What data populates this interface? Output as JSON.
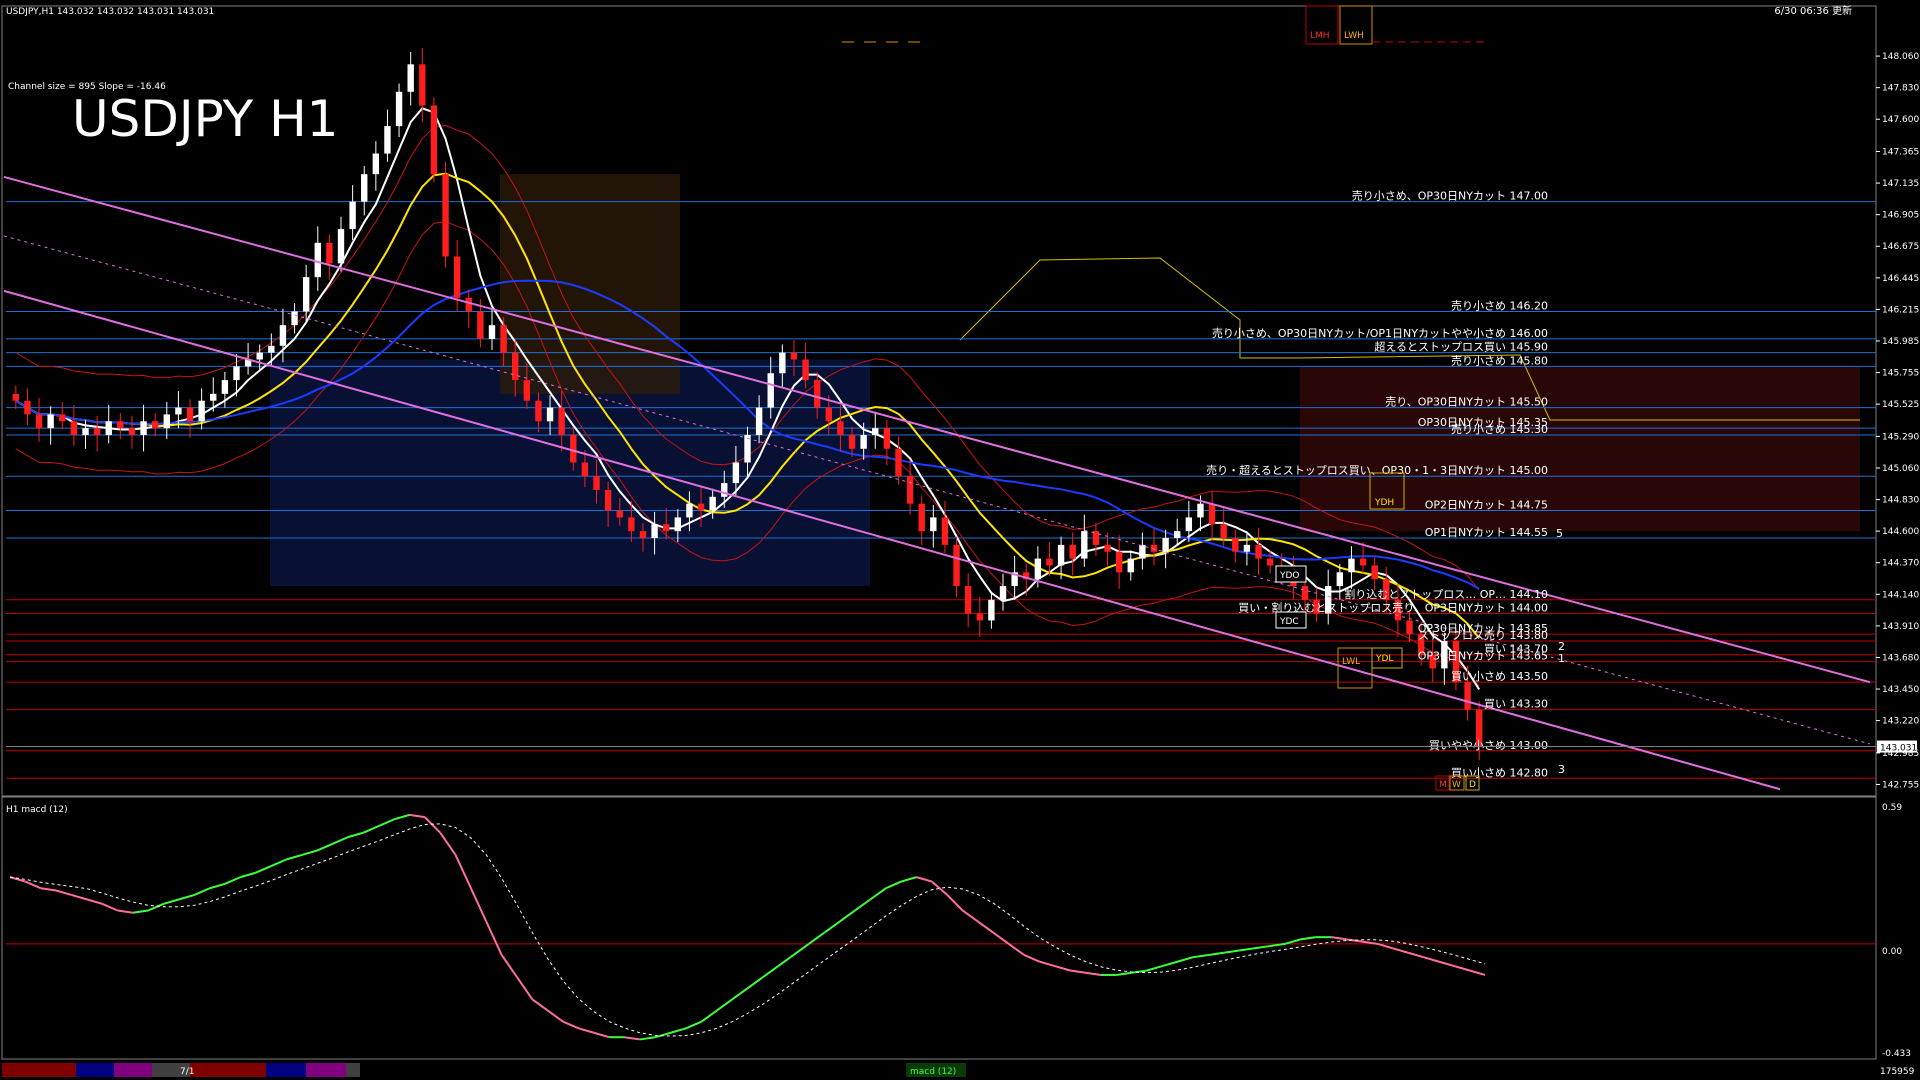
{
  "header": {
    "symbol_line": "USDJPY,H1  143.032 143.032 143.031 143.031",
    "datetime": "6/30 06:36 更新",
    "channel_info": "Channel size = 895 Slope = -16.46",
    "big_title": "USDJPY H1"
  },
  "markers_top": {
    "lmh": "LMH",
    "lwh": "LWH"
  },
  "boxes": {
    "ydh": "YDH",
    "ydo": "YDO",
    "ydc": "YDC",
    "ydl": "YDL",
    "lwl": "LWL",
    "m": "M",
    "w": "W",
    "d": "D"
  },
  "price_axis": {
    "ticks": [
      "148.060",
      "147.830",
      "147.600",
      "147.365",
      "147.135",
      "146.905",
      "146.675",
      "146.445",
      "146.215",
      "145.985",
      "145.755",
      "145.525",
      "145.290",
      "145.060",
      "144.830",
      "144.600",
      "144.370",
      "144.140",
      "143.910",
      "143.680",
      "143.450",
      "143.220",
      "142.985",
      "142.755"
    ],
    "current_price": "143.031"
  },
  "macd_axis": {
    "ticks": [
      "0.59",
      "0.00",
      "-0.433"
    ],
    "label": "H1  macd (12)"
  },
  "levels": [
    {
      "price": 147.0,
      "text": "売り小さめ、OP30日NYカット 147.00",
      "color": "#1e6fd9"
    },
    {
      "price": 146.2,
      "text": "売り小さめ 146.20",
      "color": "#1e6fd9"
    },
    {
      "price": 146.0,
      "text": "売り小さめ、OP30日NYカット/OP1日NYカットやや小さめ 146.00",
      "color": "#1e6fd9"
    },
    {
      "price": 145.9,
      "text": "超えるとストップロス買い 145.90",
      "color": "#1e6fd9"
    },
    {
      "price": 145.8,
      "text": "売り小さめ 145.80",
      "color": "#1e6fd9"
    },
    {
      "price": 145.5,
      "text": "売り、OP30日NYカット 145.50",
      "color": "#1e6fd9"
    },
    {
      "price": 145.35,
      "text": "OP30日NYカット 145.35",
      "color": "#1e6fd9"
    },
    {
      "price": 145.3,
      "text": "売り小さめ 145.30",
      "color": "#1e6fd9"
    },
    {
      "price": 145.0,
      "text": "売り・超えるとストップロス買い、OP30・1・3日NYカット 145.00",
      "color": "#1e6fd9"
    },
    {
      "price": 144.75,
      "text": "OP2日NYカット 144.75",
      "color": "#1e6fd9"
    },
    {
      "price": 144.55,
      "text": "OP1日NYカット 144.55",
      "color": "#1e6fd9"
    },
    {
      "price": 144.1,
      "text": "割り込むとストップロス… OP… 144.10",
      "color": "#c00000"
    },
    {
      "price": 144.0,
      "text": "買い・割り込むとストップロス売り、OP3日NYカット 144.00",
      "color": "#c00000"
    },
    {
      "price": 143.85,
      "text": "OP30日NYカット 143.85",
      "color": "#c00000"
    },
    {
      "price": 143.8,
      "text": "ストップロス売り 143.80",
      "color": "#c00000"
    },
    {
      "price": 143.7,
      "text": "買い 143.70",
      "color": "#c00000"
    },
    {
      "price": 143.65,
      "text": "OP30日NYカット 143.65",
      "color": "#c00000"
    },
    {
      "price": 143.5,
      "text": "買い小さめ 143.50",
      "color": "#c00000"
    },
    {
      "price": 143.3,
      "text": "買い 143.30",
      "color": "#c00000"
    },
    {
      "price": 143.0,
      "text": "買いやや小さめ 143.00",
      "color": "#c00000"
    },
    {
      "price": 142.8,
      "text": "買い小さめ 142.80",
      "color": "#c00000"
    }
  ],
  "channel_numbers": [
    "5",
    "2",
    "1",
    "3"
  ],
  "bottom_bar": {
    "tab_label": "7/1",
    "indicator": "macd (12)",
    "counter": "175959"
  },
  "chart_data": {
    "type": "candlestick",
    "title": "USDJPY H1",
    "ylim": [
      142.7,
      148.25
    ],
    "macd_ylim": [
      -0.5,
      0.62
    ],
    "closes": [
      145.55,
      145.45,
      145.35,
      145.45,
      145.4,
      145.3,
      145.35,
      145.3,
      145.4,
      145.35,
      145.3,
      145.4,
      145.35,
      145.45,
      145.5,
      145.4,
      145.55,
      145.6,
      145.7,
      145.8,
      145.85,
      145.9,
      145.95,
      146.1,
      146.2,
      146.45,
      146.7,
      146.55,
      146.8,
      147.0,
      147.2,
      147.35,
      147.55,
      147.8,
      148.0,
      147.7,
      147.2,
      146.6,
      146.3,
      146.2,
      146.0,
      146.1,
      145.9,
      145.7,
      145.55,
      145.4,
      145.5,
      145.3,
      145.1,
      145.0,
      144.9,
      144.75,
      144.7,
      144.6,
      144.55,
      144.65,
      144.6,
      144.7,
      144.8,
      144.75,
      144.85,
      144.95,
      145.1,
      145.3,
      145.5,
      145.75,
      145.9,
      145.85,
      145.7,
      145.5,
      145.4,
      145.3,
      145.2,
      145.3,
      145.35,
      145.2,
      145.0,
      144.8,
      144.6,
      144.7,
      144.5,
      144.2,
      144.0,
      143.95,
      144.1,
      144.2,
      144.3,
      144.25,
      144.4,
      144.35,
      144.5,
      144.4,
      144.6,
      144.5,
      144.45,
      144.3,
      144.4,
      144.5,
      144.45,
      144.55,
      144.6,
      144.7,
      144.8,
      144.65,
      144.55,
      144.45,
      144.5,
      144.4,
      144.35,
      144.3,
      144.2,
      144.1,
      144.0,
      144.2,
      144.3,
      144.4,
      144.35,
      144.25,
      144.1,
      143.95,
      143.85,
      143.7,
      143.6,
      143.8,
      143.5,
      143.3,
      143.031
    ],
    "macd": [
      0.3,
      0.28,
      0.25,
      0.24,
      0.22,
      0.2,
      0.18,
      0.15,
      0.14,
      0.15,
      0.18,
      0.2,
      0.22,
      0.25,
      0.27,
      0.3,
      0.32,
      0.35,
      0.38,
      0.4,
      0.42,
      0.45,
      0.48,
      0.5,
      0.53,
      0.56,
      0.58,
      0.57,
      0.5,
      0.4,
      0.25,
      0.1,
      -0.05,
      -0.15,
      -0.25,
      -0.3,
      -0.35,
      -0.38,
      -0.4,
      -0.42,
      -0.42,
      -0.43,
      -0.42,
      -0.4,
      -0.38,
      -0.35,
      -0.3,
      -0.25,
      -0.2,
      -0.15,
      -0.1,
      -0.05,
      0.0,
      0.05,
      0.1,
      0.15,
      0.2,
      0.25,
      0.28,
      0.3,
      0.28,
      0.22,
      0.15,
      0.1,
      0.05,
      0.0,
      -0.05,
      -0.08,
      -0.1,
      -0.12,
      -0.13,
      -0.14,
      -0.14,
      -0.13,
      -0.12,
      -0.1,
      -0.08,
      -0.06,
      -0.05,
      -0.04,
      -0.03,
      -0.02,
      -0.01,
      0.0,
      0.02,
      0.03,
      0.03,
      0.02,
      0.01,
      0.0,
      -0.02,
      -0.04,
      -0.06,
      -0.08,
      -0.1,
      -0.12,
      -0.14
    ],
    "colors": {
      "up": "#ffffff",
      "down": "#ff1e1e",
      "ma_fast": "#ffffff",
      "ma_mid": "#ffe500",
      "ma_slow": "#1a3cff",
      "bb": "#c81414",
      "channel": "#e070e0",
      "macd": "#ff6e9e",
      "macd_up": "#3cff3c",
      "signal": "#ffffff"
    }
  }
}
